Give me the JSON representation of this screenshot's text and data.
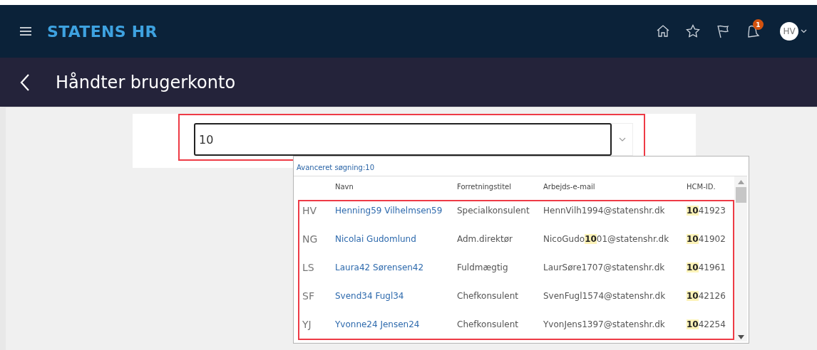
{
  "header": {
    "brand": "STATENS HR",
    "notification_count": "1",
    "avatar_initials": "HV"
  },
  "page": {
    "title": "Håndter brugerkonto"
  },
  "search": {
    "value": "10"
  },
  "dropdown": {
    "advanced_search": "Avanceret søgning:10",
    "columns": [
      "Navn",
      "Forretningstitel",
      "Arbejds-e-mail",
      "HCM-ID."
    ],
    "rows": [
      {
        "initials": "HV",
        "name": "Henning59 Vilhelmsen59",
        "title": "Specialkonsulent",
        "email": "HennVilh1994@statenshr.dk",
        "hcm_id": "**10**41923"
      },
      {
        "initials": "NG",
        "name": "Nicolai Gudomlund",
        "title": "Adm.direktør",
        "email": "NicoGudo**10**01@statenshr.dk",
        "hcm_id": "**10**41902"
      },
      {
        "initials": "LS",
        "name": "Laura42 Sørensen42",
        "title": "Fuldmægtig",
        "email": "LaurSøre1707@statenshr.dk",
        "hcm_id": "**10**41961"
      },
      {
        "initials": "SF",
        "name": "Svend34 Fugl34",
        "title": "Chefkonsulent",
        "email": "SvenFugl1574@statenshr.dk",
        "hcm_id": "**10**42126"
      },
      {
        "initials": "YJ",
        "name": "Yvonne24 Jensen24",
        "title": "Chefkonsulent",
        "email": "YvonJens1397@statenshr.dk",
        "hcm_id": "**10**42254"
      }
    ]
  }
}
